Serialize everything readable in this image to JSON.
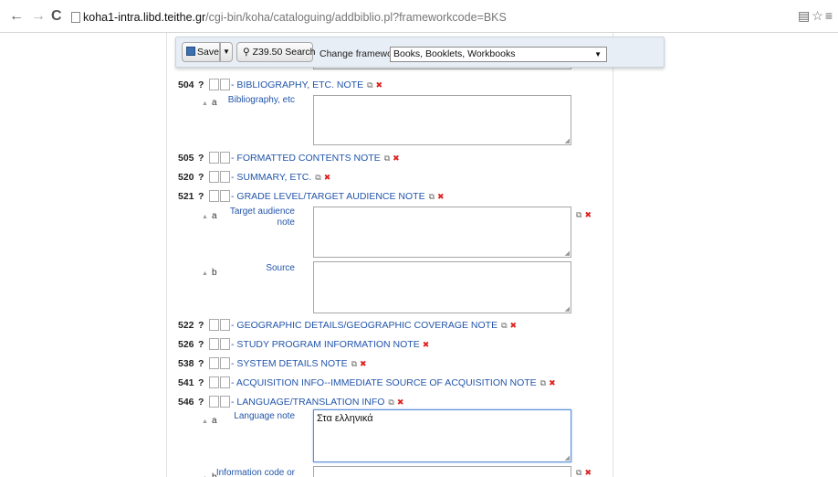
{
  "browser": {
    "back": "←",
    "forward": "→",
    "reload": "C",
    "url_host": "koha1-intra.libd.teithe.gr",
    "url_path": "/cgi-bin/koha/cataloguing/addbiblio.pl?frameworkcode=BKS"
  },
  "toolbar": {
    "save_label": "Save",
    "z3950_label": "Z39.50 Search",
    "framework_label": "Change framework:",
    "framework_value": "Books, Booklets, Workbooks"
  },
  "fields": [
    {
      "tag": "504",
      "q": "?",
      "desc": "- BIBLIOGRAPHY, ETC. NOTE"
    },
    {
      "tag": "505",
      "q": "?",
      "desc": "- FORMATTED CONTENTS NOTE"
    },
    {
      "tag": "520",
      "q": "?",
      "desc": "- SUMMARY, ETC."
    },
    {
      "tag": "521",
      "q": "?",
      "desc": "- GRADE LEVEL/TARGET AUDIENCE NOTE"
    },
    {
      "tag": "522",
      "q": "?",
      "desc": "- GEOGRAPHIC DETAILS/GEOGRAPHIC COVERAGE NOTE"
    },
    {
      "tag": "526",
      "q": "?",
      "desc": "- STUDY PROGRAM INFORMATION NOTE"
    },
    {
      "tag": "538",
      "q": "?",
      "desc": "- SYSTEM DETAILS NOTE"
    },
    {
      "tag": "541",
      "q": "?",
      "desc": "- ACQUISITION INFO--IMMEDIATE SOURCE OF ACQUISITION NOTE"
    },
    {
      "tag": "546",
      "q": "?",
      "desc": "- LANGUAGE/TRANSLATION INFO"
    }
  ],
  "subfields": {
    "f504a": {
      "code": "a",
      "label": "Bibliography, etc",
      "value": ""
    },
    "f521a": {
      "code": "a",
      "label_line1": "Target audience",
      "label_line2": "note",
      "value": ""
    },
    "f521b": {
      "code": "b",
      "label": "Source",
      "value": ""
    },
    "f546a": {
      "code": "a",
      "label": "Language note",
      "value": "Στα ελληνικά"
    },
    "f546b": {
      "code": "b",
      "label": "Information code or",
      "value": ""
    }
  },
  "icons": {
    "clone": "clone-icon",
    "delete": "delete-icon",
    "star": "star-icon",
    "menu": "menu-icon"
  }
}
